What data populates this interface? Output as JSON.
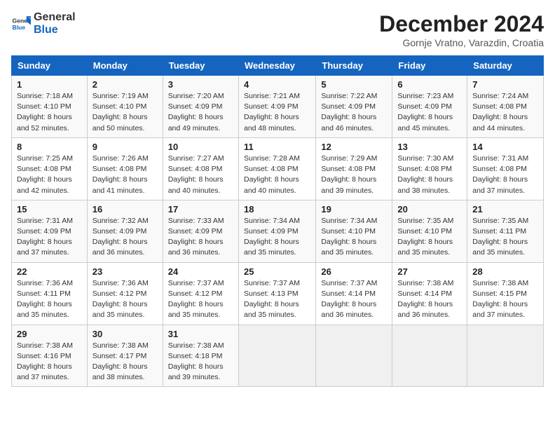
{
  "header": {
    "logo_general": "General",
    "logo_blue": "Blue",
    "title": "December 2024",
    "location": "Gornje Vratno, Varazdin, Croatia"
  },
  "columns": [
    "Sunday",
    "Monday",
    "Tuesday",
    "Wednesday",
    "Thursday",
    "Friday",
    "Saturday"
  ],
  "weeks": [
    [
      {
        "day": "1",
        "sunrise": "7:18 AM",
        "sunset": "4:10 PM",
        "daylight": "8 hours and 52 minutes."
      },
      {
        "day": "2",
        "sunrise": "7:19 AM",
        "sunset": "4:10 PM",
        "daylight": "8 hours and 50 minutes."
      },
      {
        "day": "3",
        "sunrise": "7:20 AM",
        "sunset": "4:09 PM",
        "daylight": "8 hours and 49 minutes."
      },
      {
        "day": "4",
        "sunrise": "7:21 AM",
        "sunset": "4:09 PM",
        "daylight": "8 hours and 48 minutes."
      },
      {
        "day": "5",
        "sunrise": "7:22 AM",
        "sunset": "4:09 PM",
        "daylight": "8 hours and 46 minutes."
      },
      {
        "day": "6",
        "sunrise": "7:23 AM",
        "sunset": "4:09 PM",
        "daylight": "8 hours and 45 minutes."
      },
      {
        "day": "7",
        "sunrise": "7:24 AM",
        "sunset": "4:08 PM",
        "daylight": "8 hours and 44 minutes."
      }
    ],
    [
      {
        "day": "8",
        "sunrise": "7:25 AM",
        "sunset": "4:08 PM",
        "daylight": "8 hours and 42 minutes."
      },
      {
        "day": "9",
        "sunrise": "7:26 AM",
        "sunset": "4:08 PM",
        "daylight": "8 hours and 41 minutes."
      },
      {
        "day": "10",
        "sunrise": "7:27 AM",
        "sunset": "4:08 PM",
        "daylight": "8 hours and 40 minutes."
      },
      {
        "day": "11",
        "sunrise": "7:28 AM",
        "sunset": "4:08 PM",
        "daylight": "8 hours and 40 minutes."
      },
      {
        "day": "12",
        "sunrise": "7:29 AM",
        "sunset": "4:08 PM",
        "daylight": "8 hours and 39 minutes."
      },
      {
        "day": "13",
        "sunrise": "7:30 AM",
        "sunset": "4:08 PM",
        "daylight": "8 hours and 38 minutes."
      },
      {
        "day": "14",
        "sunrise": "7:31 AM",
        "sunset": "4:08 PM",
        "daylight": "8 hours and 37 minutes."
      }
    ],
    [
      {
        "day": "15",
        "sunrise": "7:31 AM",
        "sunset": "4:09 PM",
        "daylight": "8 hours and 37 minutes."
      },
      {
        "day": "16",
        "sunrise": "7:32 AM",
        "sunset": "4:09 PM",
        "daylight": "8 hours and 36 minutes."
      },
      {
        "day": "17",
        "sunrise": "7:33 AM",
        "sunset": "4:09 PM",
        "daylight": "8 hours and 36 minutes."
      },
      {
        "day": "18",
        "sunrise": "7:34 AM",
        "sunset": "4:09 PM",
        "daylight": "8 hours and 35 minutes."
      },
      {
        "day": "19",
        "sunrise": "7:34 AM",
        "sunset": "4:10 PM",
        "daylight": "8 hours and 35 minutes."
      },
      {
        "day": "20",
        "sunrise": "7:35 AM",
        "sunset": "4:10 PM",
        "daylight": "8 hours and 35 minutes."
      },
      {
        "day": "21",
        "sunrise": "7:35 AM",
        "sunset": "4:11 PM",
        "daylight": "8 hours and 35 minutes."
      }
    ],
    [
      {
        "day": "22",
        "sunrise": "7:36 AM",
        "sunset": "4:11 PM",
        "daylight": "8 hours and 35 minutes."
      },
      {
        "day": "23",
        "sunrise": "7:36 AM",
        "sunset": "4:12 PM",
        "daylight": "8 hours and 35 minutes."
      },
      {
        "day": "24",
        "sunrise": "7:37 AM",
        "sunset": "4:12 PM",
        "daylight": "8 hours and 35 minutes."
      },
      {
        "day": "25",
        "sunrise": "7:37 AM",
        "sunset": "4:13 PM",
        "daylight": "8 hours and 35 minutes."
      },
      {
        "day": "26",
        "sunrise": "7:37 AM",
        "sunset": "4:14 PM",
        "daylight": "8 hours and 36 minutes."
      },
      {
        "day": "27",
        "sunrise": "7:38 AM",
        "sunset": "4:14 PM",
        "daylight": "8 hours and 36 minutes."
      },
      {
        "day": "28",
        "sunrise": "7:38 AM",
        "sunset": "4:15 PM",
        "daylight": "8 hours and 37 minutes."
      }
    ],
    [
      {
        "day": "29",
        "sunrise": "7:38 AM",
        "sunset": "4:16 PM",
        "daylight": "8 hours and 37 minutes."
      },
      {
        "day": "30",
        "sunrise": "7:38 AM",
        "sunset": "4:17 PM",
        "daylight": "8 hours and 38 minutes."
      },
      {
        "day": "31",
        "sunrise": "7:38 AM",
        "sunset": "4:18 PM",
        "daylight": "8 hours and 39 minutes."
      },
      null,
      null,
      null,
      null
    ]
  ],
  "labels": {
    "sunrise": "Sunrise:",
    "sunset": "Sunset:",
    "daylight": "Daylight:"
  }
}
